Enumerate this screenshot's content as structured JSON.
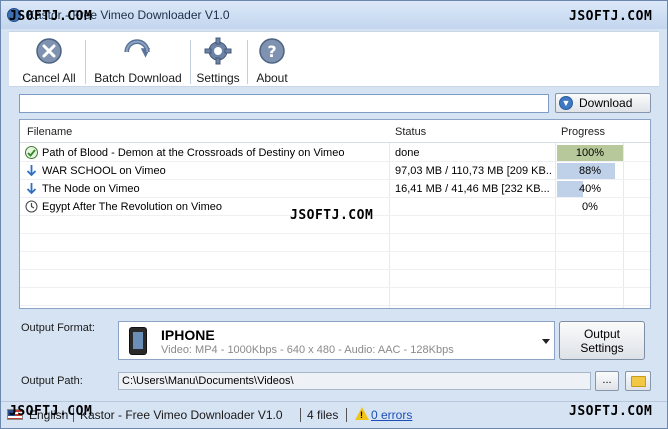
{
  "window": {
    "title": "Kastor - Free Vimeo Downloader V1.0"
  },
  "watermarks": {
    "top_left": "JSOFTJ.COM",
    "top_right": "JSOFTJ.COM",
    "center": "JSOFTJ.COM",
    "bottom_left": "JSOFTJ.COM",
    "bottom_right": "JSOFTJ.COM"
  },
  "toolbar": {
    "cancel_all": "Cancel All",
    "batch_download": "Batch Download",
    "settings": "Settings",
    "about": "About"
  },
  "url_bar": {
    "value": "",
    "download_label": "Download"
  },
  "table": {
    "headers": {
      "filename": "Filename",
      "status": "Status",
      "progress": "Progress"
    },
    "rows": [
      {
        "icon": "checkmark-icon",
        "filename": "Path of Blood - Demon at the Crossroads of Destiny on Vimeo",
        "status": "done",
        "progress_label": "100%",
        "progress": 1.0,
        "color": "#b7c99a"
      },
      {
        "icon": "download-arrow-icon",
        "filename": "WAR SCHOOL on Vimeo",
        "status": "97,03 MB / 110,73 MB [209 KB...",
        "progress_label": "88%",
        "progress": 0.88,
        "color": "#bfd1e8"
      },
      {
        "icon": "download-arrow-icon",
        "filename": "The Node on Vimeo",
        "status": "16,41 MB / 41,46 MB [232 KB...",
        "progress_label": "40%",
        "progress": 0.4,
        "color": "#bfd1e8"
      },
      {
        "icon": "clock-icon",
        "filename": "Egypt After The Revolution on Vimeo",
        "status": "",
        "progress_label": "0%",
        "progress": 0.0,
        "color": "#bfd1e8"
      }
    ]
  },
  "output": {
    "format_label": "Output Format:",
    "format_name": "IPHONE",
    "format_desc": "Video: MP4 - 1000Kbps - 640 x 480 - Audio: AAC - 128Kbps",
    "settings_label": "Output\nSettings",
    "path_label": "Output Path:",
    "path_value": "C:\\Users\\Manu\\Documents\\Videos\\",
    "browse_label": "..."
  },
  "statusbar": {
    "language": "English",
    "app_name": "Kastor - Free Vimeo Downloader V1.0",
    "files": "4 files",
    "errors": "0 errors"
  }
}
